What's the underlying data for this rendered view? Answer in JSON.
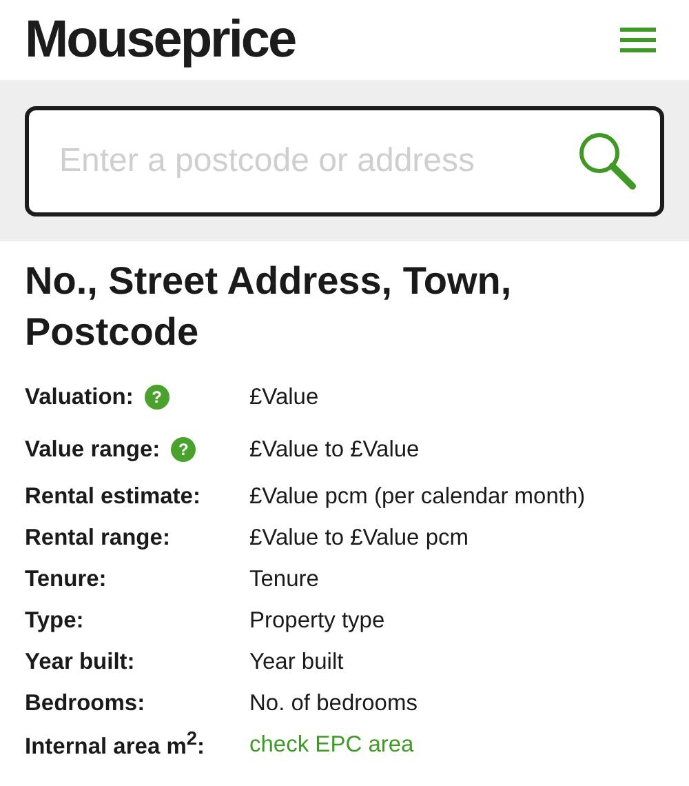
{
  "header": {
    "logo": "Mouseprice"
  },
  "search": {
    "placeholder": "Enter a postcode or address"
  },
  "property": {
    "title": "No., Street Address, Town, Postcode",
    "rows": [
      {
        "label": "Valuation:",
        "help": "?",
        "kind": "text",
        "value": "£Value"
      },
      {
        "label": "Value range:",
        "help": "?",
        "kind": "text",
        "value": "£Value to £Value"
      },
      {
        "label": "Rental estimate:",
        "kind": "text",
        "value": "£Value pcm (per calendar month)"
      },
      {
        "label": "Rental range:",
        "kind": "text",
        "value": "£Value to £Value pcm"
      },
      {
        "label": "Tenure:",
        "kind": "text",
        "value": "Tenure"
      },
      {
        "label": "Type:",
        "kind": "text",
        "value": "Property type"
      },
      {
        "label": "Year built:",
        "kind": "text",
        "value": "Year built"
      },
      {
        "label": "Bedrooms:",
        "kind": "text",
        "value": "No. of bedrooms"
      },
      {
        "label": "Internal area m$^{2}$:",
        "kind": "link",
        "value": "check EPC area"
      }
    ]
  }
}
